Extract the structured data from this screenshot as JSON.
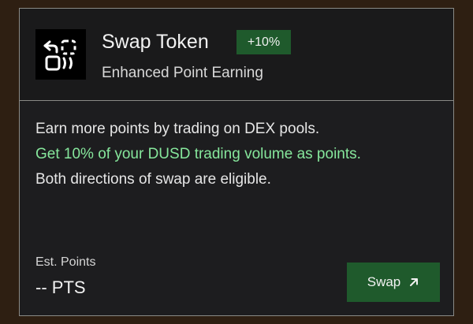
{
  "card": {
    "title": "Swap Token",
    "badge": "+10%",
    "subtitle": "Enhanced Point Earning",
    "description": [
      "Earn more points by trading on DEX pools.",
      "Get 10% of your DUSD trading volume as points.",
      "Both directions of swap are eligible."
    ],
    "estimate": {
      "label": "Est. Points",
      "value": "-- PTS"
    },
    "action": {
      "label": "Swap",
      "icon": "arrow-up-right-icon"
    },
    "icon": "swap-token-icon"
  },
  "colors": {
    "card_background": "#1d1d1f",
    "accent_green": "#1f5a2c",
    "highlight_text": "#86e79c",
    "page_background": "#2e1f12"
  }
}
